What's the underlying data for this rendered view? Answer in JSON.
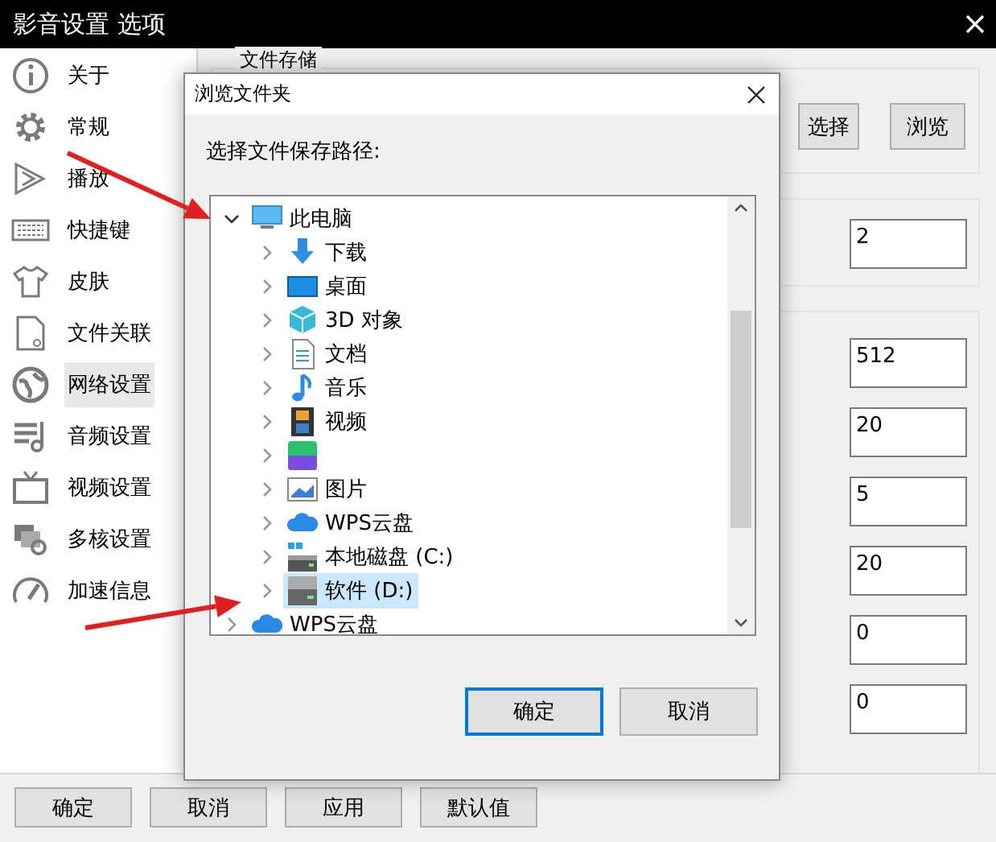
{
  "window": {
    "title": "影音设置 选项"
  },
  "sidebar": {
    "items": [
      {
        "label": "关于",
        "selected": false
      },
      {
        "label": "常规",
        "selected": false
      },
      {
        "label": "播放",
        "selected": false
      },
      {
        "label": "快捷键",
        "selected": false
      },
      {
        "label": "皮肤",
        "selected": false
      },
      {
        "label": "文件关联",
        "selected": false
      },
      {
        "label": "网络设置",
        "selected": true
      },
      {
        "label": "音频设置",
        "selected": false
      },
      {
        "label": "视频设置",
        "selected": false
      },
      {
        "label": "多核设置",
        "selected": false
      },
      {
        "label": "加速信息",
        "selected": false
      }
    ]
  },
  "storage": {
    "label": "文件存储",
    "buttons": [
      "选择",
      "浏览"
    ]
  },
  "connections": {
    "values": [
      "2"
    ]
  },
  "network": {
    "values": [
      "512",
      "20",
      "5",
      "20",
      "0",
      "0"
    ]
  },
  "footer_buttons": [
    "确定",
    "取消",
    "应用",
    "默认值"
  ],
  "dialog": {
    "title": "浏览文件夹",
    "prompt": "选择文件保存路径:",
    "tree": [
      {
        "label": "此电脑",
        "expanded": true,
        "selected": false,
        "children": [
          {
            "label": "下载",
            "expanded": false,
            "selected": false
          },
          {
            "label": "桌面",
            "expanded": false,
            "selected": false
          },
          {
            "label": "3D 对象",
            "expanded": false,
            "selected": false
          },
          {
            "label": "文档",
            "expanded": false,
            "selected": false
          },
          {
            "label": "音乐",
            "expanded": false,
            "selected": false
          },
          {
            "label": "视频",
            "expanded": false,
            "selected": false
          },
          {
            "expanded": false,
            "selected": false
          },
          {
            "label": "图片",
            "expanded": false,
            "selected": false
          },
          {
            "label": "WPS云盘",
            "expanded": false,
            "selected": false
          },
          {
            "label": "本地磁盘 (C:)",
            "expanded": false,
            "selected": false
          },
          {
            "label": "软件 (D:)",
            "expanded": false,
            "selected": true
          }
        ]
      },
      {
        "label": "WPS云盘",
        "expanded": false,
        "selected": false
      }
    ],
    "buttons": [
      {
        "label": "确定",
        "default": true
      },
      {
        "label": "取消",
        "default": false
      }
    ]
  }
}
